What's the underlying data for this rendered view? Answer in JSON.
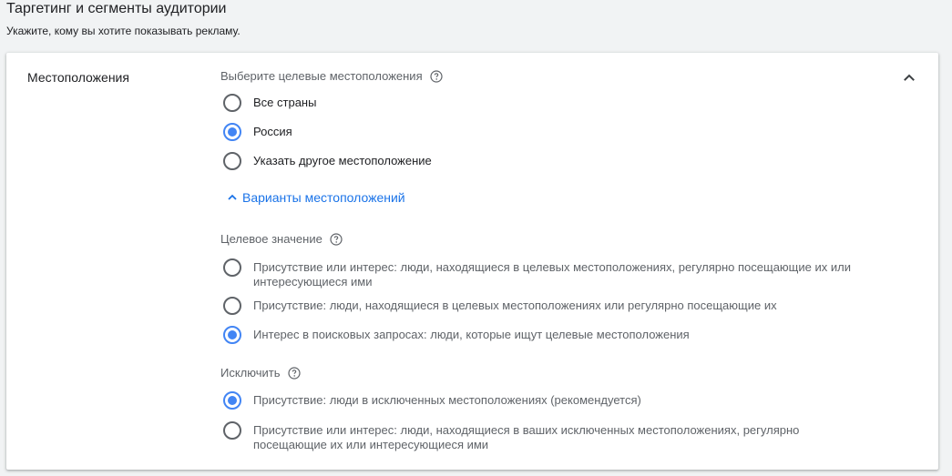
{
  "header": {
    "title": "Таргетинг и сегменты аудитории",
    "subtitle": "Укажите, кому вы хотите показывать рекламу."
  },
  "card": {
    "section_title": "Местоположения",
    "target_locations": {
      "label": "Выберите целевые местоположения",
      "options": [
        {
          "label": "Все страны",
          "selected": false
        },
        {
          "label": "Россия",
          "selected": true
        },
        {
          "label": "Указать другое местоположение",
          "selected": false
        }
      ]
    },
    "options_link": "Варианты местоположений",
    "target_value": {
      "label": "Целевое значение",
      "options": [
        {
          "label": "Присутствие или интерес: люди, находящиеся в целевых местоположениях, регулярно посещающие их или интересующиеся ими",
          "selected": false
        },
        {
          "label": "Присутствие: люди, находящиеся в целевых местоположениях или регулярно посещающие их",
          "selected": false
        },
        {
          "label": "Интерес в поисковых запросах: люди, которые ищут целевые местоположения",
          "selected": true
        }
      ]
    },
    "exclude": {
      "label": "Исключить",
      "options": [
        {
          "label": "Присутствие: люди в исключенных местоположениях (рекомендуется)",
          "selected": true
        },
        {
          "label": "Присутствие или интерес: люди, находящиеся в ваших исключенных местоположениях, регулярно посещающие их или интересующиеся ими",
          "selected": false
        }
      ]
    }
  },
  "icons": {
    "help": "help-circle-icon",
    "collapse": "chevron-up-icon",
    "expand_link": "chevron-up-icon"
  },
  "colors": {
    "accent": "#4285f4",
    "link": "#1a73e8",
    "background": "#f1f3f4",
    "card": "#ffffff"
  }
}
